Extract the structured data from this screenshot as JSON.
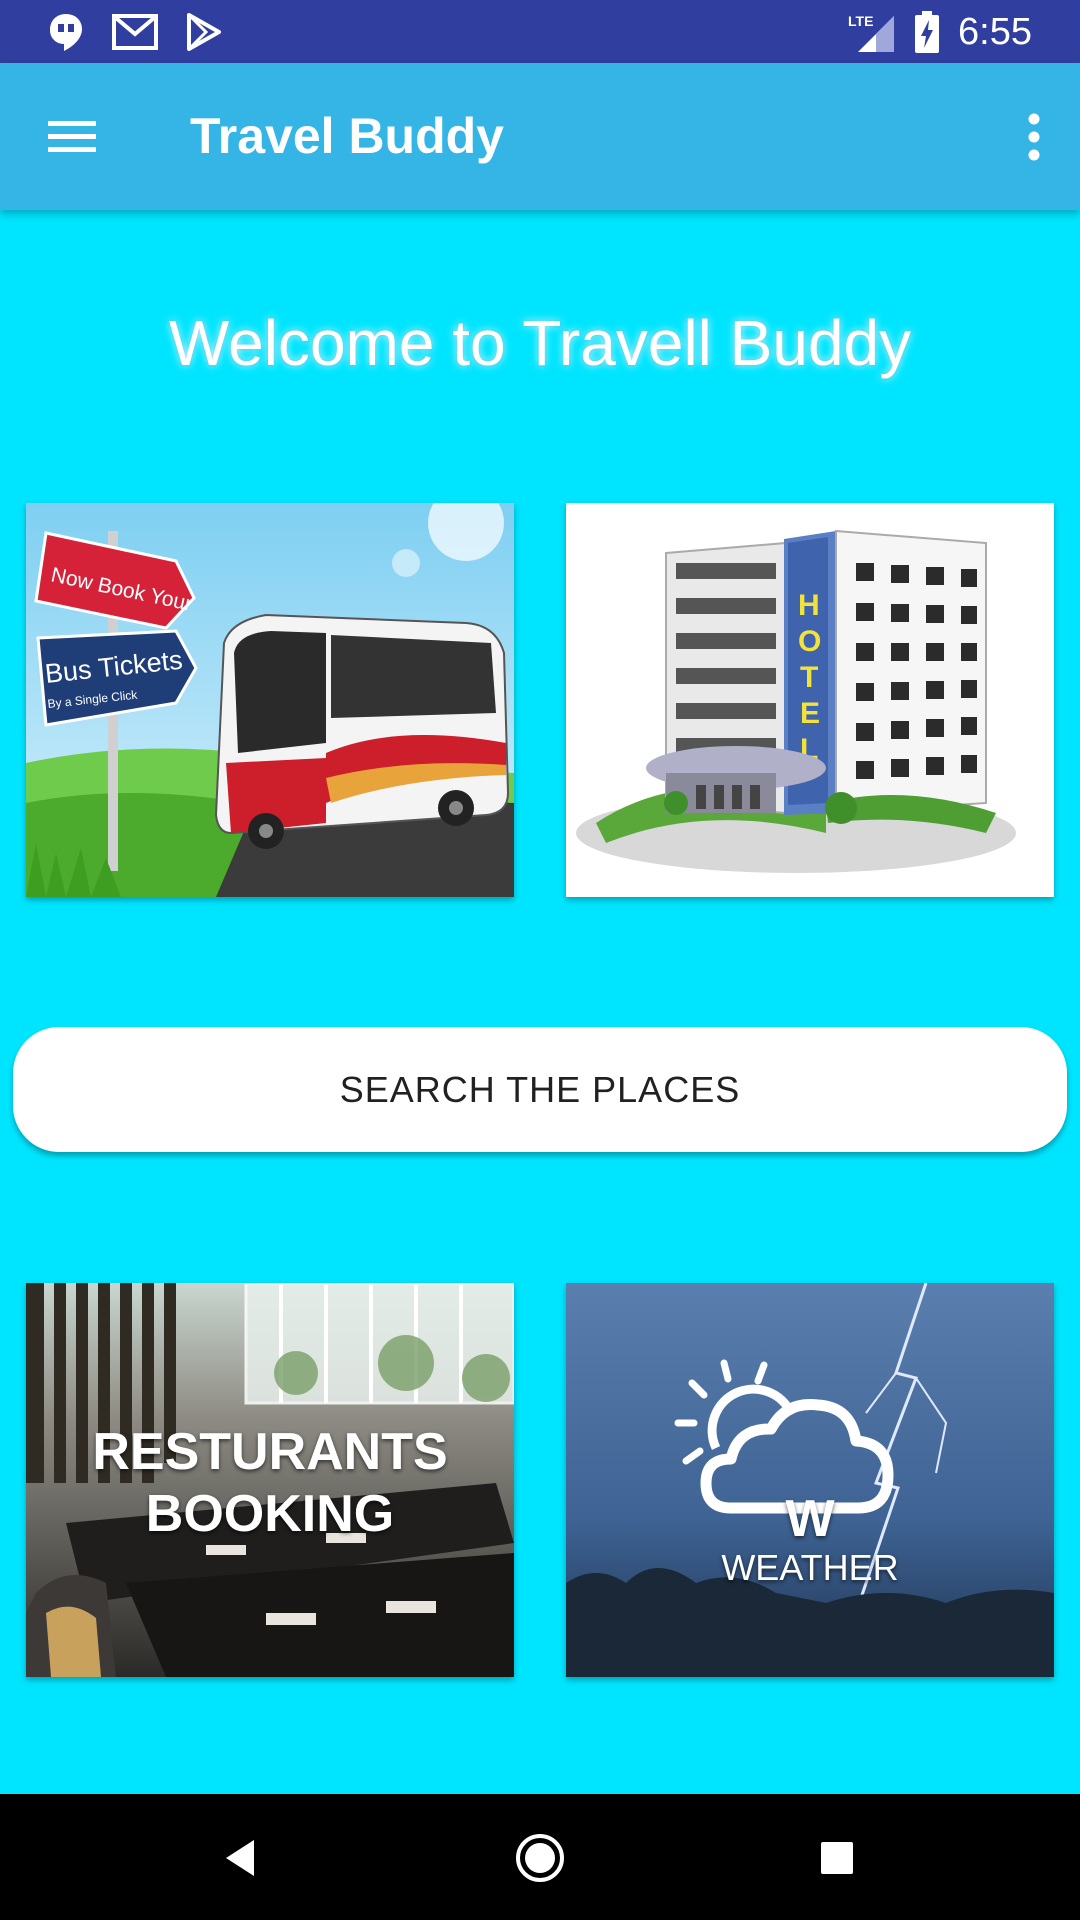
{
  "status_bar": {
    "time": "6:55",
    "network": "LTE",
    "left_icons": [
      "hangouts-icon",
      "gmail-icon",
      "play-store-icon"
    ]
  },
  "app_bar": {
    "title": "Travel Buddy",
    "menu_icon": "hamburger-menu-icon",
    "overflow_icon": "more-vert-icon"
  },
  "welcome_text": "Welcome to Travell Buddy",
  "tiles": {
    "bus": {
      "sign_top": "Now Book Your",
      "sign_main": "Bus Tickets",
      "sign_sub": "By a Single Click"
    },
    "hotel": {
      "sign": "HOTEL"
    },
    "restaurants": {
      "line1": "RESTURANTS",
      "line2": "BOOKING"
    },
    "weather": {
      "letter": "W",
      "label": "WEATHER"
    }
  },
  "search_button": "SEARCH THE PLACES",
  "colors": {
    "background": "#00e5ff",
    "status_bar": "#303f9f",
    "app_bar": "#35b5e5"
  }
}
